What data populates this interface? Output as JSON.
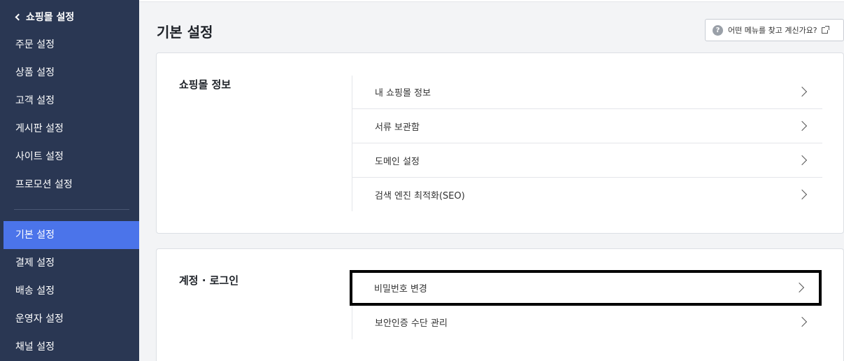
{
  "sidebar": {
    "back_label": "쇼핑몰 설정",
    "group1": [
      "주문 설정",
      "상품 설정",
      "고객 설정",
      "게시판 설정",
      "사이트 설정",
      "프로모션 설정"
    ],
    "group2": [
      "기본 설정",
      "결제 설정",
      "배송 설정",
      "운영자 설정",
      "채널 설정"
    ],
    "active_item": "기본 설정"
  },
  "main": {
    "page_title": "기본 설정",
    "help_button": {
      "icon": "?",
      "label": "어떤 메뉴를 찾고 계신가요?",
      "trailing_icon": "external-link-icon"
    }
  },
  "sections": [
    {
      "title": "쇼핑몰 정보",
      "items": [
        "내 쇼핑몰 정보",
        "서류 보관함",
        "도메인 설정",
        "검색 엔진 최적화(SEO)"
      ]
    },
    {
      "title": "계정 · 로그인",
      "items": [
        "비밀번호 변경",
        "보안인증 수단 관리"
      ],
      "highlighted_item": "비밀번호 변경"
    }
  ],
  "colors": {
    "sidebar_bg": "#2a3753",
    "active_item_bg": "#4b74ea",
    "page_bg": "#f3f4f6",
    "highlight_border": "#000000"
  }
}
